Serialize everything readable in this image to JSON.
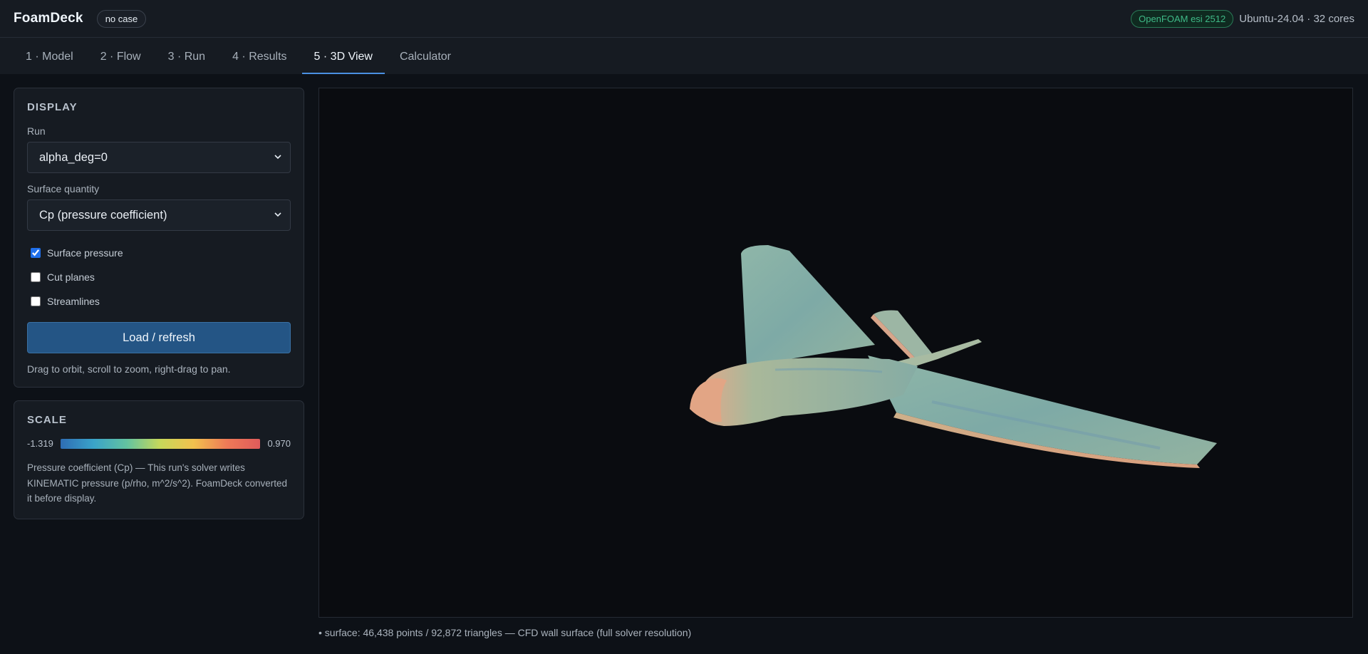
{
  "header": {
    "brand": "FoamDeck",
    "case_badge": "no case",
    "version_badge": "OpenFOAM esi 2512",
    "system_info": "Ubuntu-24.04 · 32 cores"
  },
  "tabs": [
    {
      "label": "1 · Model"
    },
    {
      "label": "2 · Flow"
    },
    {
      "label": "3 · Run"
    },
    {
      "label": "4 · Results"
    },
    {
      "label": "5 · 3D View",
      "active": true
    },
    {
      "label": "Calculator"
    }
  ],
  "display": {
    "title": "DISPLAY",
    "run_label": "Run",
    "run_value": "alpha_deg=0",
    "quantity_label": "Surface quantity",
    "quantity_value": "Cp (pressure coefficient)",
    "checkboxes": [
      {
        "label": "Surface pressure",
        "checked": true
      },
      {
        "label": "Cut planes",
        "checked": false
      },
      {
        "label": "Streamlines",
        "checked": false
      }
    ],
    "load_button": "Load / refresh",
    "hint": "Drag to orbit, scroll to zoom, right-drag to pan."
  },
  "scale": {
    "title": "SCALE",
    "min": "-1.319",
    "max": "0.970",
    "description": "Pressure coefficient (Cp) — This run's solver writes KINEMATIC pressure (p/rho, m^2/s^2). FoamDeck converted it before display."
  },
  "viewer": {
    "status": "• surface: 46,438 points / 92,872 triangles — CFD wall surface (full solver resolution)"
  },
  "colors": {
    "accent": "#4a90e2",
    "version_green": "#3fb987",
    "button": "#245585"
  }
}
